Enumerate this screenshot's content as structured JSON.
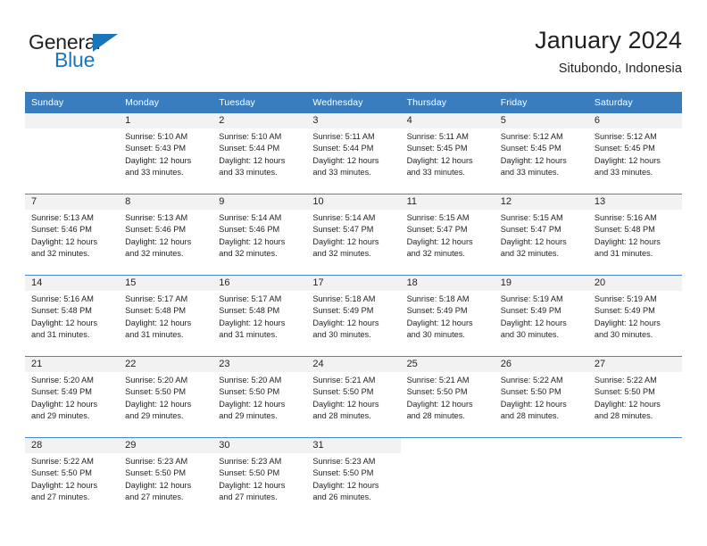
{
  "brand": {
    "name_top": "General",
    "name_bottom": "Blue",
    "triangle_color": "#1b75bb",
    "text_color": "#231f20"
  },
  "header": {
    "title": "January 2024",
    "subtitle": "Situbondo, Indonesia"
  },
  "theme": {
    "header_bg": "#3a7dbf",
    "header_text": "#ffffff",
    "week_separator": "#4a86c4",
    "daynum_band_bg": "#f2f2f2",
    "body_text": "#231f20"
  },
  "weekday_headers": [
    "Sunday",
    "Monday",
    "Tuesday",
    "Wednesday",
    "Thursday",
    "Friday",
    "Saturday"
  ],
  "weeks": [
    [
      {
        "day": "",
        "lines": []
      },
      {
        "day": "1",
        "lines": [
          "Sunrise: 5:10 AM",
          "Sunset: 5:43 PM",
          "Daylight: 12 hours",
          "and 33 minutes."
        ]
      },
      {
        "day": "2",
        "lines": [
          "Sunrise: 5:10 AM",
          "Sunset: 5:44 PM",
          "Daylight: 12 hours",
          "and 33 minutes."
        ]
      },
      {
        "day": "3",
        "lines": [
          "Sunrise: 5:11 AM",
          "Sunset: 5:44 PM",
          "Daylight: 12 hours",
          "and 33 minutes."
        ]
      },
      {
        "day": "4",
        "lines": [
          "Sunrise: 5:11 AM",
          "Sunset: 5:45 PM",
          "Daylight: 12 hours",
          "and 33 minutes."
        ]
      },
      {
        "day": "5",
        "lines": [
          "Sunrise: 5:12 AM",
          "Sunset: 5:45 PM",
          "Daylight: 12 hours",
          "and 33 minutes."
        ]
      },
      {
        "day": "6",
        "lines": [
          "Sunrise: 5:12 AM",
          "Sunset: 5:45 PM",
          "Daylight: 12 hours",
          "and 33 minutes."
        ]
      }
    ],
    [
      {
        "day": "7",
        "lines": [
          "Sunrise: 5:13 AM",
          "Sunset: 5:46 PM",
          "Daylight: 12 hours",
          "and 32 minutes."
        ]
      },
      {
        "day": "8",
        "lines": [
          "Sunrise: 5:13 AM",
          "Sunset: 5:46 PM",
          "Daylight: 12 hours",
          "and 32 minutes."
        ]
      },
      {
        "day": "9",
        "lines": [
          "Sunrise: 5:14 AM",
          "Sunset: 5:46 PM",
          "Daylight: 12 hours",
          "and 32 minutes."
        ]
      },
      {
        "day": "10",
        "lines": [
          "Sunrise: 5:14 AM",
          "Sunset: 5:47 PM",
          "Daylight: 12 hours",
          "and 32 minutes."
        ]
      },
      {
        "day": "11",
        "lines": [
          "Sunrise: 5:15 AM",
          "Sunset: 5:47 PM",
          "Daylight: 12 hours",
          "and 32 minutes."
        ]
      },
      {
        "day": "12",
        "lines": [
          "Sunrise: 5:15 AM",
          "Sunset: 5:47 PM",
          "Daylight: 12 hours",
          "and 32 minutes."
        ]
      },
      {
        "day": "13",
        "lines": [
          "Sunrise: 5:16 AM",
          "Sunset: 5:48 PM",
          "Daylight: 12 hours",
          "and 31 minutes."
        ]
      }
    ],
    [
      {
        "day": "14",
        "lines": [
          "Sunrise: 5:16 AM",
          "Sunset: 5:48 PM",
          "Daylight: 12 hours",
          "and 31 minutes."
        ]
      },
      {
        "day": "15",
        "lines": [
          "Sunrise: 5:17 AM",
          "Sunset: 5:48 PM",
          "Daylight: 12 hours",
          "and 31 minutes."
        ]
      },
      {
        "day": "16",
        "lines": [
          "Sunrise: 5:17 AM",
          "Sunset: 5:48 PM",
          "Daylight: 12 hours",
          "and 31 minutes."
        ]
      },
      {
        "day": "17",
        "lines": [
          "Sunrise: 5:18 AM",
          "Sunset: 5:49 PM",
          "Daylight: 12 hours",
          "and 30 minutes."
        ]
      },
      {
        "day": "18",
        "lines": [
          "Sunrise: 5:18 AM",
          "Sunset: 5:49 PM",
          "Daylight: 12 hours",
          "and 30 minutes."
        ]
      },
      {
        "day": "19",
        "lines": [
          "Sunrise: 5:19 AM",
          "Sunset: 5:49 PM",
          "Daylight: 12 hours",
          "and 30 minutes."
        ]
      },
      {
        "day": "20",
        "lines": [
          "Sunrise: 5:19 AM",
          "Sunset: 5:49 PM",
          "Daylight: 12 hours",
          "and 30 minutes."
        ]
      }
    ],
    [
      {
        "day": "21",
        "lines": [
          "Sunrise: 5:20 AM",
          "Sunset: 5:49 PM",
          "Daylight: 12 hours",
          "and 29 minutes."
        ]
      },
      {
        "day": "22",
        "lines": [
          "Sunrise: 5:20 AM",
          "Sunset: 5:50 PM",
          "Daylight: 12 hours",
          "and 29 minutes."
        ]
      },
      {
        "day": "23",
        "lines": [
          "Sunrise: 5:20 AM",
          "Sunset: 5:50 PM",
          "Daylight: 12 hours",
          "and 29 minutes."
        ]
      },
      {
        "day": "24",
        "lines": [
          "Sunrise: 5:21 AM",
          "Sunset: 5:50 PM",
          "Daylight: 12 hours",
          "and 28 minutes."
        ]
      },
      {
        "day": "25",
        "lines": [
          "Sunrise: 5:21 AM",
          "Sunset: 5:50 PM",
          "Daylight: 12 hours",
          "and 28 minutes."
        ]
      },
      {
        "day": "26",
        "lines": [
          "Sunrise: 5:22 AM",
          "Sunset: 5:50 PM",
          "Daylight: 12 hours",
          "and 28 minutes."
        ]
      },
      {
        "day": "27",
        "lines": [
          "Sunrise: 5:22 AM",
          "Sunset: 5:50 PM",
          "Daylight: 12 hours",
          "and 28 minutes."
        ]
      }
    ],
    [
      {
        "day": "28",
        "lines": [
          "Sunrise: 5:22 AM",
          "Sunset: 5:50 PM",
          "Daylight: 12 hours",
          "and 27 minutes."
        ]
      },
      {
        "day": "29",
        "lines": [
          "Sunrise: 5:23 AM",
          "Sunset: 5:50 PM",
          "Daylight: 12 hours",
          "and 27 minutes."
        ]
      },
      {
        "day": "30",
        "lines": [
          "Sunrise: 5:23 AM",
          "Sunset: 5:50 PM",
          "Daylight: 12 hours",
          "and 27 minutes."
        ]
      },
      {
        "day": "31",
        "lines": [
          "Sunrise: 5:23 AM",
          "Sunset: 5:50 PM",
          "Daylight: 12 hours",
          "and 26 minutes."
        ]
      },
      {
        "day": "",
        "lines": []
      },
      {
        "day": "",
        "lines": []
      },
      {
        "day": "",
        "lines": []
      }
    ]
  ]
}
